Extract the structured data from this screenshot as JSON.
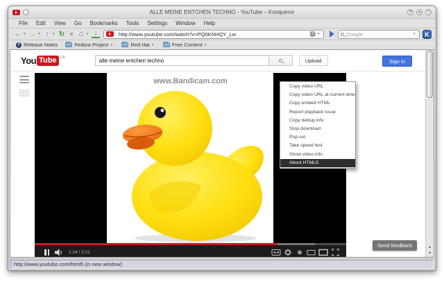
{
  "titlebar": {
    "title": "ALLE MEINE ENTCHEN TECHNO - YouTube – Konqueror"
  },
  "menubar": {
    "items": [
      "File",
      "Edit",
      "View",
      "Go",
      "Bookmarks",
      "Tools",
      "Settings",
      "Window",
      "Help"
    ]
  },
  "toolbar": {
    "url": "http://www.youtube.com/watch?v=PQ0KNHQY_Lw",
    "search_placeholder": "Google",
    "kde_logo_letter": "K"
  },
  "bookmarks_bar": {
    "items": [
      "Release Notes",
      "Fedora Project",
      "Red Hat",
      "Free Content"
    ]
  },
  "youtube": {
    "logo_you": "You",
    "logo_tube": "Tube",
    "logo_region": "GB",
    "search_value": "alle meine entchen techno",
    "upload_label": "Upload",
    "signin_label": "Sign in",
    "send_feedback_label": "Send feedback"
  },
  "player": {
    "watermark": "www.Bandicam.com",
    "time": "1:24 / 3:21",
    "progress_percent": 78,
    "loaded_percent": 90
  },
  "context_menu": {
    "items": [
      "Copy video URL",
      "Copy video URL at current time",
      "Copy embed HTML",
      "Report playback issue",
      "Copy debug info",
      "Stop download",
      "Pop out",
      "Take speed test",
      "Show video info",
      "About HTML5"
    ],
    "highlight_index": 9
  },
  "statusbar": {
    "text": "http://www.youtube.com/html5 (in new window)"
  },
  "icons": {
    "back": "←",
    "forward": "→",
    "up": "↑",
    "reload": "↻",
    "stop": "×",
    "home": "⌂",
    "download": "↓",
    "dropdown": "▾",
    "clear": "×",
    "win_min": "▾",
    "win_max": "▴",
    "win_close": "×",
    "scroll_up": "▴",
    "scroll_down": "▾",
    "fedora": "f",
    "dots": "···"
  },
  "colors": {
    "youtube_red": "#cc181e",
    "signin_blue": "#4274db",
    "menu_highlight": "#2e2e2e",
    "progress_red": "#cc181e"
  }
}
